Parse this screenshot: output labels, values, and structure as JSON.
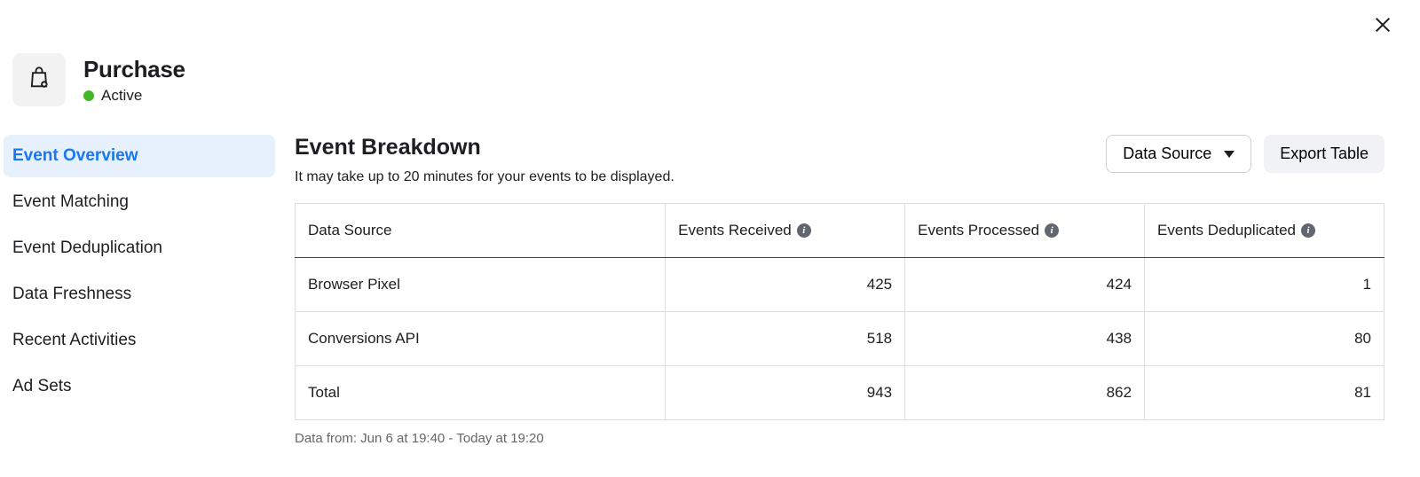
{
  "event": {
    "title": "Purchase",
    "status_text": "Active",
    "status_color": "#42b72a",
    "icon": "shopping-bag-icon"
  },
  "close_icon": "×",
  "sidebar": {
    "items": [
      {
        "label": "Event Overview",
        "active": true
      },
      {
        "label": "Event Matching",
        "active": false
      },
      {
        "label": "Event Deduplication",
        "active": false
      },
      {
        "label": "Data Freshness",
        "active": false
      },
      {
        "label": "Recent Activities",
        "active": false
      },
      {
        "label": "Ad Sets",
        "active": false
      }
    ]
  },
  "main": {
    "title": "Event Breakdown",
    "subtitle": "It may take up to 20 minutes for your events to be displayed.",
    "dropdown_label": "Data Source",
    "export_label": "Export Table",
    "data_from": "Data from: Jun 6 at 19:40 - Today at 19:20"
  },
  "table": {
    "columns": [
      {
        "label": "Data Source",
        "info": false
      },
      {
        "label": "Events Received",
        "info": true
      },
      {
        "label": "Events Processed",
        "info": true
      },
      {
        "label": "Events Deduplicated",
        "info": true
      }
    ],
    "rows": [
      {
        "source": "Browser Pixel",
        "received": "425",
        "processed": "424",
        "deduplicated": "1"
      },
      {
        "source": "Conversions API",
        "received": "518",
        "processed": "438",
        "deduplicated": "80"
      },
      {
        "source": "Total",
        "received": "943",
        "processed": "862",
        "deduplicated": "81"
      }
    ]
  }
}
